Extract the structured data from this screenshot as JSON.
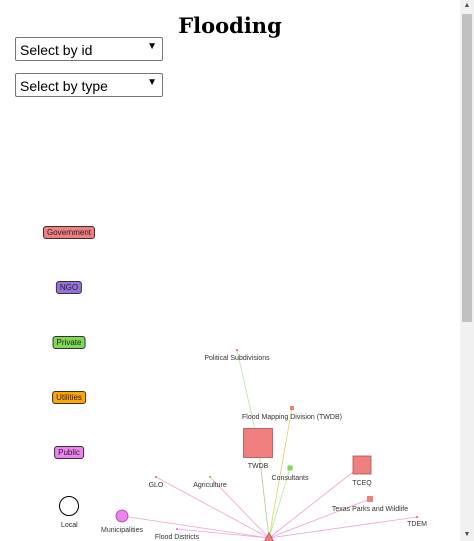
{
  "title": "Flooding",
  "selects": {
    "by_id": "Select by id",
    "by_type": "Select by type"
  },
  "legend": [
    {
      "label": "Government",
      "color": "#f08080"
    },
    {
      "label": "NGO",
      "color": "#9370db"
    },
    {
      "label": "Private",
      "color": "#7ed957"
    },
    {
      "label": "Utilities",
      "color": "#ffa500"
    },
    {
      "label": "Public",
      "color": "#ee82ee"
    }
  ],
  "local_label": "Local",
  "nodes": [
    {
      "id": "political-subdivisions",
      "label": "Political Subdivisions",
      "type": "Government"
    },
    {
      "id": "flood-mapping-division",
      "label": "Flood Mapping Division (TWDB)",
      "type": "Government"
    },
    {
      "id": "twdb",
      "label": "TWDB",
      "type": "Government"
    },
    {
      "id": "consultants",
      "label": "Consultants",
      "type": "Private"
    },
    {
      "id": "tceq",
      "label": "TCEQ",
      "type": "Government"
    },
    {
      "id": "glo",
      "label": "GLO",
      "type": "Government"
    },
    {
      "id": "agriculture",
      "label": "Agriculture",
      "type": "Private"
    },
    {
      "id": "texas-parks-wildlife",
      "label": "Texas Parks and Wildlife",
      "type": "Government"
    },
    {
      "id": "tdem",
      "label": "TDEM",
      "type": "Government"
    },
    {
      "id": "municipalities",
      "label": "Municipalities",
      "type": "Public"
    },
    {
      "id": "flood-districts",
      "label": "Flood Districts",
      "type": "Public"
    },
    {
      "id": "hub",
      "label": "",
      "type": "Government"
    }
  ],
  "scrollbar": {
    "up_icon": "arrow-up-icon",
    "down_icon": "arrow-down-icon"
  }
}
